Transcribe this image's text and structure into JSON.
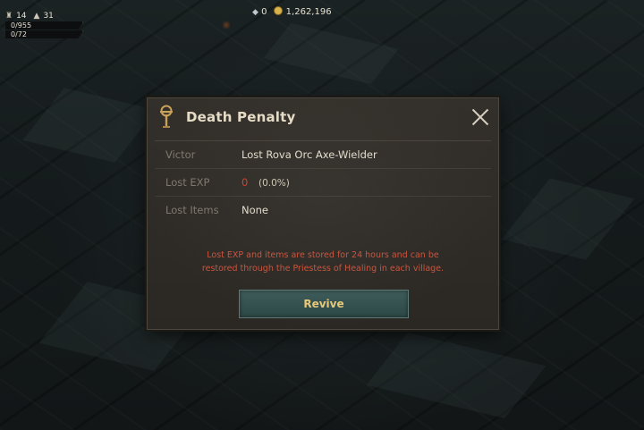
{
  "hud": {
    "level": "14",
    "stat": "31",
    "hp_text": "0/955",
    "mp_text": "0/72",
    "gems": "0",
    "gold": "1,262,196"
  },
  "modal": {
    "title": "Death Penalty",
    "rows": [
      {
        "label": "Victor",
        "value": "Lost Rova Orc Axe-Wielder"
      },
      {
        "label": "Lost EXP",
        "value_num": "0",
        "value_pct": "(0.0%)"
      },
      {
        "label": "Lost Items",
        "value": "None"
      }
    ],
    "notice_line1": "Lost EXP and items are stored for 24 hours and can be",
    "notice_line2": "restored through the Priestess of Healing in each village.",
    "button": "Revive"
  },
  "colors": {
    "accent_gold": "#e8c877",
    "warning_red": "#d8402c",
    "button_teal": "#3e5c5a"
  },
  "icons": {
    "title_icon": "ankh-icon",
    "close": "close-icon",
    "gem": "gem-icon",
    "coin": "gold-coin-icon"
  }
}
